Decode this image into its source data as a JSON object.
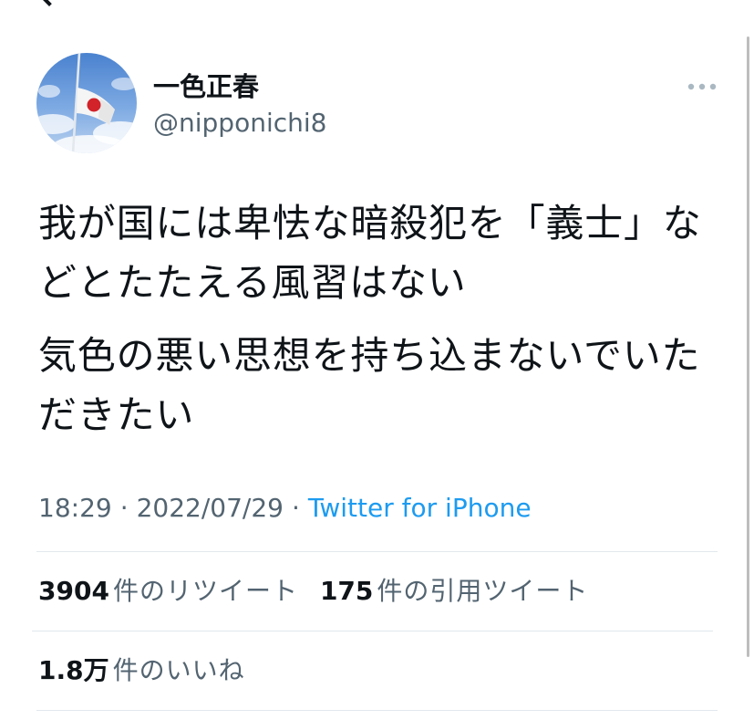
{
  "header": {
    "back_icon": "chevron-left-icon"
  },
  "tweet": {
    "author": {
      "name": "一色正春",
      "handle": "@nipponichi8",
      "avatar_icon": "japanese-flag-avatar"
    },
    "more_icon": "more-horizontal-icon",
    "text_paragraphs": [
      "我が国には卑怯な暗殺犯を「義士」などとたたえる風習はない",
      "気色の悪い思想を持ち込まないでいただきたい"
    ],
    "time": "18:29",
    "separator": "·",
    "date": "2022/07/29",
    "source": "Twitter for iPhone"
  },
  "stats": {
    "retweets": {
      "count": "3904",
      "label": "件のリツイート"
    },
    "quotes": {
      "count": "175",
      "label": "件の引用ツイート"
    },
    "likes": {
      "count": "1.8万",
      "label": "件のいいね"
    }
  },
  "colors": {
    "text": "#0f1419",
    "secondary": "#536471",
    "link": "#1d9bf0",
    "divider": "#e1e8ed",
    "dots": "#aab8c2"
  }
}
